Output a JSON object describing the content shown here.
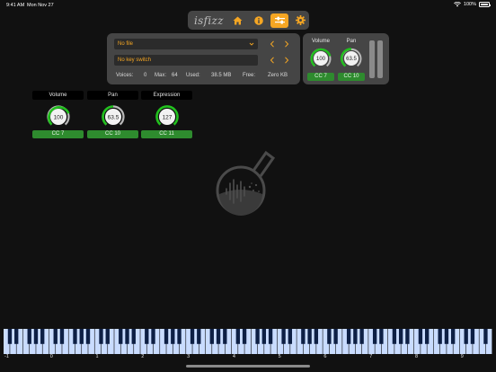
{
  "status_bar": {
    "time": "9:41 AM",
    "date": "Mon Nov 27",
    "battery": "100%"
  },
  "toolbar": {
    "logo": "isfizz",
    "buttons": [
      {
        "icon": "home-icon",
        "active": false
      },
      {
        "icon": "info-icon",
        "active": false
      },
      {
        "icon": "sliders-icon",
        "active": true
      },
      {
        "icon": "gear-icon",
        "active": false
      }
    ]
  },
  "file_panel": {
    "file_select": "No file",
    "key_switch": "No key switch",
    "stats": {
      "voices_label": "Voices:",
      "voices_value": "0",
      "max_label": "Max:",
      "max_value": "64",
      "used_label": "Used:",
      "used_value": "38.5 MB",
      "free_label": "Free:",
      "free_value": "Zero KB"
    }
  },
  "side_panel": {
    "volume": {
      "label": "Volume",
      "value": "100",
      "cc": "CC 7"
    },
    "pan": {
      "label": "Pan",
      "value": "63.5",
      "cc": "CC 10"
    }
  },
  "controls": [
    {
      "label": "Volume",
      "value": "100",
      "cc": "CC 7",
      "level": 0.79
    },
    {
      "label": "Pan",
      "value": "63.5",
      "cc": "CC 10",
      "level": 0.5
    },
    {
      "label": "Expression",
      "value": "127",
      "cc": "CC 11",
      "level": 1.0
    }
  ],
  "keyboard": {
    "octave_labels": [
      "-1",
      "0",
      "1",
      "2",
      "3",
      "4",
      "5",
      "6",
      "7",
      "8",
      "9"
    ]
  },
  "colors": {
    "accent": "#f5a623",
    "cc_green": "#2e8b2e",
    "knob_green": "#22c01e",
    "white_key": "#c9dcff",
    "black_key": "#0d1f44",
    "panel": "#454545",
    "background": "#111111"
  }
}
